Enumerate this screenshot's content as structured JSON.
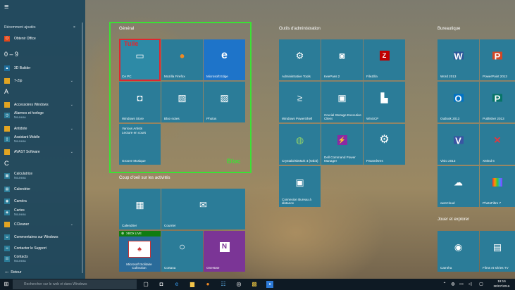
{
  "start_menu": {
    "hamburger": "≡",
    "recent_header": "Récemment ajoutés",
    "recent_close": "×",
    "letters": [
      "0 – 9",
      "A",
      "C"
    ],
    "apps": [
      {
        "name": "Obtenir Office",
        "sub": "",
        "color": "#e2471a",
        "glyph": "O"
      },
      {
        "name": "3D Builder",
        "sub": "",
        "color": "#1f6e9c",
        "glyph": "▲"
      },
      {
        "name": "7-Zip",
        "sub": "",
        "color": "#e1a422",
        "glyph": "■"
      },
      {
        "name": "Accessoires Windows",
        "sub": "",
        "color": "#e1a422",
        "glyph": "■"
      },
      {
        "name": "Alarmes et horloge",
        "sub": "Nouveau",
        "color": "#2b7c98",
        "glyph": "◷"
      },
      {
        "name": "Antidote",
        "sub": "",
        "color": "#e1a422",
        "glyph": "■"
      },
      {
        "name": "Assistant Mobile",
        "sub": "Nouveau",
        "color": "#2b7c98",
        "glyph": "▯"
      },
      {
        "name": "AVAST Software",
        "sub": "",
        "color": "#e1a422",
        "glyph": "■"
      },
      {
        "name": "Calculatrice",
        "sub": "Nouveau",
        "color": "#2b7c98",
        "glyph": "▦"
      },
      {
        "name": "Calendrier",
        "sub": "",
        "color": "#2b7c98",
        "glyph": "▤"
      },
      {
        "name": "Caméra",
        "sub": "",
        "color": "#2b7c98",
        "glyph": "◉"
      },
      {
        "name": "Cartes",
        "sub": "Nouveau",
        "color": "#2b7c98",
        "glyph": "◈"
      },
      {
        "name": "CCleaner",
        "sub": "",
        "color": "#e1a422",
        "glyph": "■"
      },
      {
        "name": "Commentaires sur Windows",
        "sub": "",
        "color": "#2b7c98",
        "glyph": "☺"
      },
      {
        "name": "Contacter le Support",
        "sub": "",
        "color": "#2b7c98",
        "glyph": "☺"
      },
      {
        "name": "Contacts",
        "sub": "Nouveau",
        "color": "#2b7c98",
        "glyph": "☷"
      }
    ],
    "back_label": "Retour"
  },
  "groups": {
    "general": "Général",
    "activities": "Coup d'oeil sur les activités",
    "admin": "Outils d'administration",
    "office": "Bureautique",
    "play": "Jouer et explorer"
  },
  "tiles": [
    {
      "label": "Ce PC",
      "glyph": "🖥",
      "color": "#2d8aa6"
    },
    {
      "label": "Mozilla Firefox",
      "glyph": "◉",
      "color": "#2b7c98"
    },
    {
      "label": "Microsoft Edge",
      "glyph": "e",
      "color": "#1e74c9"
    },
    {
      "label": "Windows Store",
      "glyph": "🛍",
      "color": "#2b7c98"
    },
    {
      "label": "Bloc-notes",
      "glyph": "▧",
      "color": "#2b7c98"
    },
    {
      "label": "Photos",
      "glyph": "▨",
      "color": "#2b7c98"
    },
    {
      "label": "Groove Musique",
      "glyph": "",
      "color": "#2b7c98",
      "extra": "Various Artists\nLecture en cours"
    },
    {
      "label": "Calendrier",
      "glyph": "▦",
      "color": "#2b7c98"
    },
    {
      "label": "Courrier",
      "glyph": "✉",
      "color": "#2b7c98"
    },
    {
      "label": "Microsoft Solitaire Collection",
      "glyph": "♠",
      "color": "#2a6b9a",
      "badge": "XBOX LIVE"
    },
    {
      "label": "Cortana",
      "glyph": "○",
      "color": "#2b7c98"
    },
    {
      "label": "OneNote",
      "glyph": "N",
      "color": "#7b3596"
    },
    {
      "label": "Administrative Tools",
      "glyph": "⚙",
      "color": "#2b7c98"
    },
    {
      "label": "KeePass 2",
      "glyph": "🔒",
      "color": "#2b7c98"
    },
    {
      "label": "FileZilla",
      "glyph": "Z",
      "color": "#2b7c98"
    },
    {
      "label": "Windows PowerShell",
      "glyph": "≥",
      "color": "#2b7c98"
    },
    {
      "label": "Crucial Storage Executive Client",
      "glyph": "▣",
      "color": "#2b7c98"
    },
    {
      "label": "WinSCP",
      "glyph": "▙",
      "color": "#2b7c98"
    },
    {
      "label": "CrystalDiskMark 4 (64bit)",
      "glyph": "◍",
      "color": "#2b7c98"
    },
    {
      "label": "Dell Command Power Manager",
      "glyph": "⚡",
      "color": "#2b7c98"
    },
    {
      "label": "Paramètres",
      "glyph": "⚙",
      "color": "#2b7c98"
    },
    {
      "label": "Connexion Bureau à distance",
      "glyph": "🖳",
      "color": "#2b7c98"
    },
    {
      "label": "Word 2013",
      "glyph": "W",
      "color": "#2b7c98"
    },
    {
      "label": "PowerPoint 2013",
      "glyph": "P",
      "color": "#2b7c98"
    },
    {
      "label": "Outlook 2013",
      "glyph": "O",
      "color": "#2b7c98"
    },
    {
      "label": "Publisher 2013",
      "glyph": "P",
      "color": "#2b7c98"
    },
    {
      "label": "Visio 2013",
      "glyph": "V",
      "color": "#2b7c98"
    },
    {
      "label": "XMind 6",
      "glyph": "✕",
      "color": "#2b7c98"
    },
    {
      "label": "ownCloud",
      "glyph": "☁",
      "color": "#2b7c98"
    },
    {
      "label": "PhotoFiltre 7",
      "glyph": "▩",
      "color": "#2b7c98"
    },
    {
      "label": "Caméra",
      "glyph": "◉",
      "color": "#2b7c98"
    },
    {
      "label": "Films et séries TV",
      "glyph": "🎬",
      "color": "#2b7c98"
    }
  ],
  "annotations": {
    "tuile": "Tuile",
    "bloc": "Bloc"
  },
  "taskbar": {
    "search_placeholder": "Rechercher sur le web et dans Windows",
    "time": "19:16",
    "date": "30/07/2016"
  }
}
